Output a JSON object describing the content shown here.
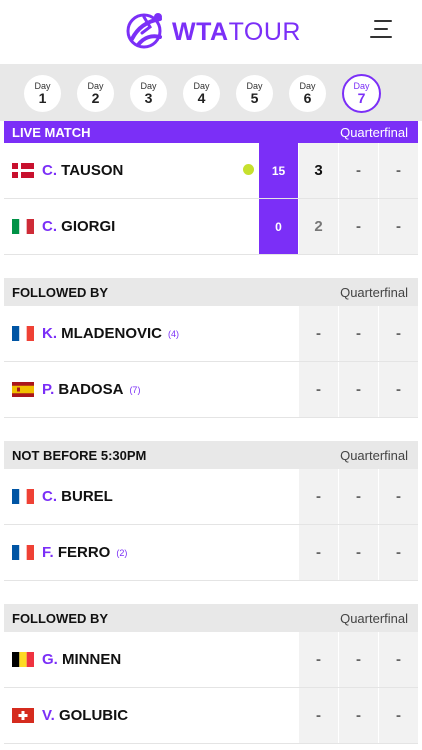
{
  "header": {
    "logo_primary": "WTA",
    "logo_secondary": "TOUR"
  },
  "days": [
    {
      "label": "Day",
      "num": "1"
    },
    {
      "label": "Day",
      "num": "2"
    },
    {
      "label": "Day",
      "num": "3"
    },
    {
      "label": "Day",
      "num": "4"
    },
    {
      "label": "Day",
      "num": "5"
    },
    {
      "label": "Day",
      "num": "6"
    },
    {
      "label": "Day",
      "num": "7"
    }
  ],
  "active_day": "7",
  "colors": {
    "accent": "#7b2ff7",
    "serve_ball": "#c6e02e",
    "section_bg": "#e8e8e8"
  },
  "blocks": [
    {
      "title": "LIVE MATCH",
      "round": "Quarterfinal",
      "players": [
        {
          "flag": "denmark",
          "initial": "C.",
          "surname": "TAUSON",
          "seed": "",
          "serving": true,
          "point": "15",
          "sets": [
            "3",
            "-",
            "-"
          ]
        },
        {
          "flag": "italy",
          "initial": "C.",
          "surname": "GIORGI",
          "seed": "",
          "serving": false,
          "point": "0",
          "sets": [
            "2",
            "-",
            "-"
          ]
        }
      ]
    },
    {
      "title": "FOLLOWED BY",
      "round": "Quarterfinal",
      "players": [
        {
          "flag": "france",
          "initial": "K.",
          "surname": "MLADENOVIC",
          "seed": "(4)",
          "sets": [
            "-",
            "-",
            "-"
          ]
        },
        {
          "flag": "spain",
          "initial": "P.",
          "surname": "BADOSA",
          "seed": "(7)",
          "sets": [
            "-",
            "-",
            "-"
          ]
        }
      ]
    },
    {
      "title": "NOT BEFORE 5:30PM",
      "round": "Quarterfinal",
      "players": [
        {
          "flag": "france",
          "initial": "C.",
          "surname": "BUREL",
          "seed": "",
          "sets": [
            "-",
            "-",
            "-"
          ]
        },
        {
          "flag": "france",
          "initial": "F.",
          "surname": "FERRO",
          "seed": "(2)",
          "sets": [
            "-",
            "-",
            "-"
          ]
        }
      ]
    },
    {
      "title": "FOLLOWED BY",
      "round": "Quarterfinal",
      "players": [
        {
          "flag": "belgium",
          "initial": "G.",
          "surname": "MINNEN",
          "seed": "",
          "sets": [
            "-",
            "-",
            "-"
          ]
        },
        {
          "flag": "switzerland",
          "initial": "V.",
          "surname": "GOLUBIC",
          "seed": "",
          "sets": [
            "-",
            "-",
            "-"
          ]
        }
      ]
    }
  ]
}
